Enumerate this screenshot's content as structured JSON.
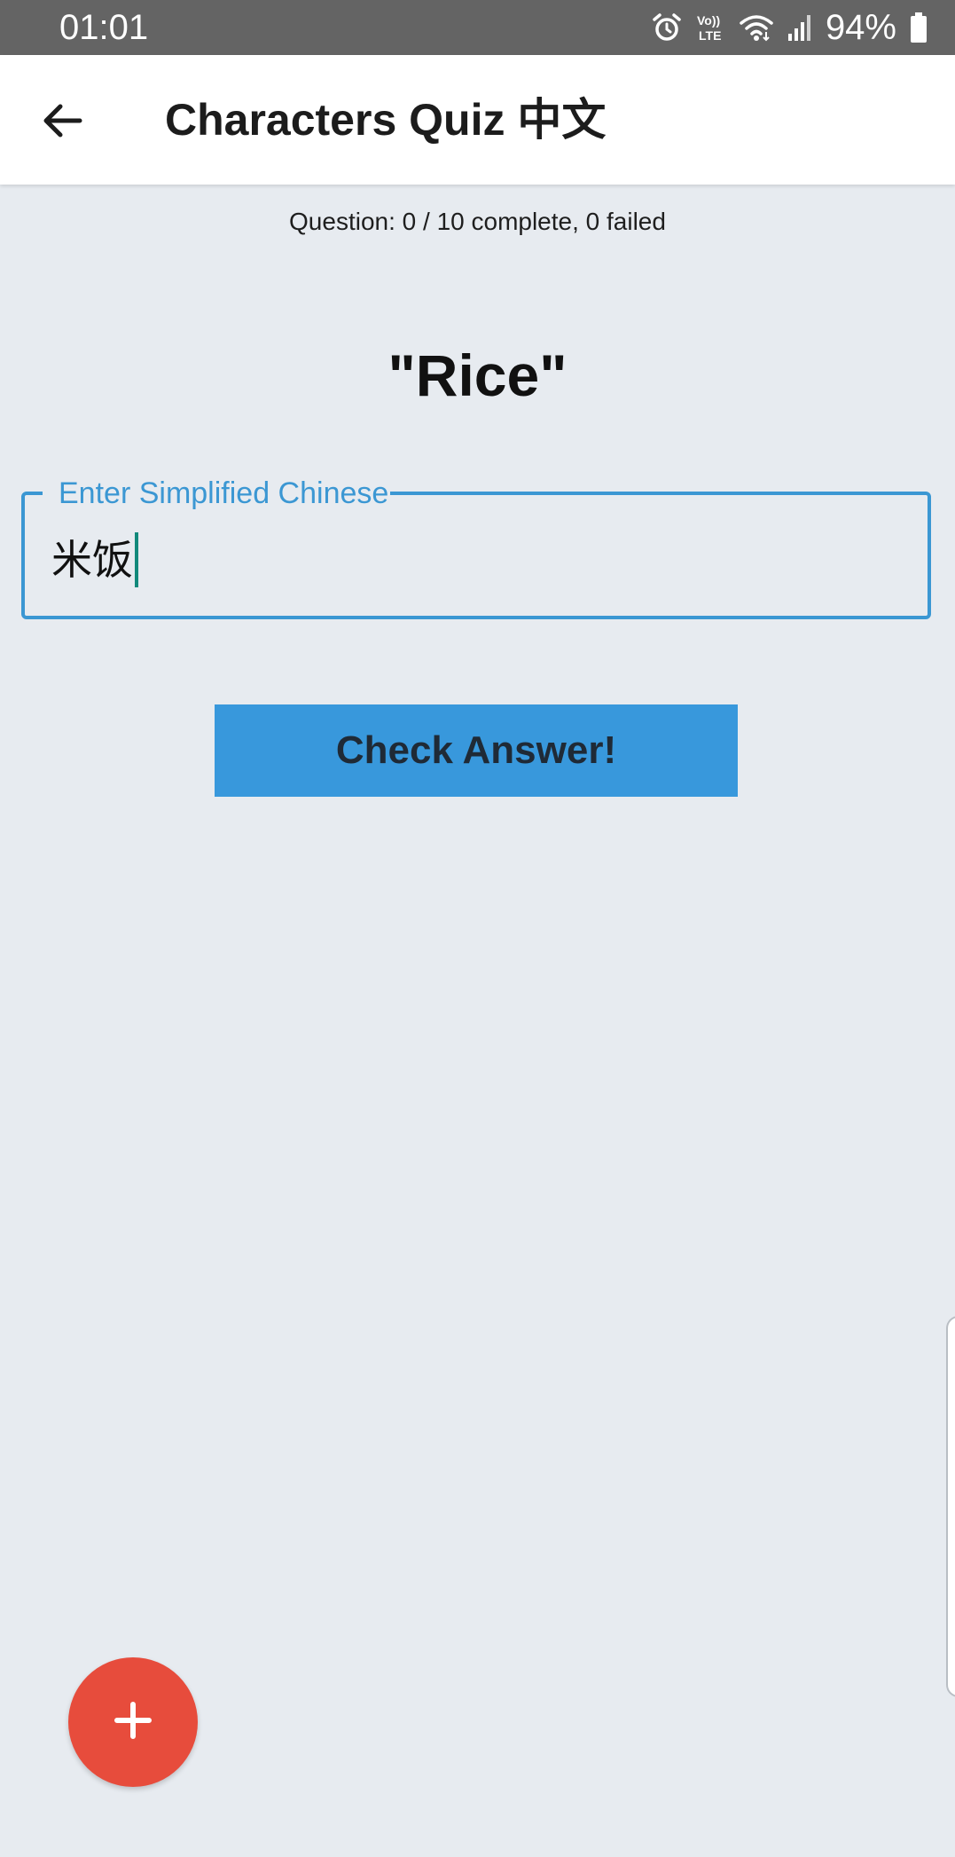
{
  "status_bar": {
    "time": "01:01",
    "battery": "94%",
    "icons": [
      "alarm-icon",
      "volte-icon",
      "wifi-icon",
      "signal-icon",
      "battery-icon"
    ],
    "volte_top": "Vo))",
    "volte_bottom": "LTE"
  },
  "app_bar": {
    "title": "Characters Quiz 中文",
    "back_icon": "arrow-left-icon"
  },
  "quiz": {
    "progress": "Question: 0 / 10 complete, 0 failed",
    "question": "\"Rice\"",
    "input_label": "Enter Simplified Chinese",
    "input_value": "米饭",
    "check_button": "Check Answer!"
  },
  "fab": {
    "label": "+",
    "icon": "plus-icon"
  },
  "colors": {
    "status_bar": "#646464",
    "app_bar": "#ffffff",
    "background": "#e7ebf0",
    "accent_blue": "#3898dc",
    "fab_red": "#e74c3c",
    "caret": "#12897b"
  }
}
